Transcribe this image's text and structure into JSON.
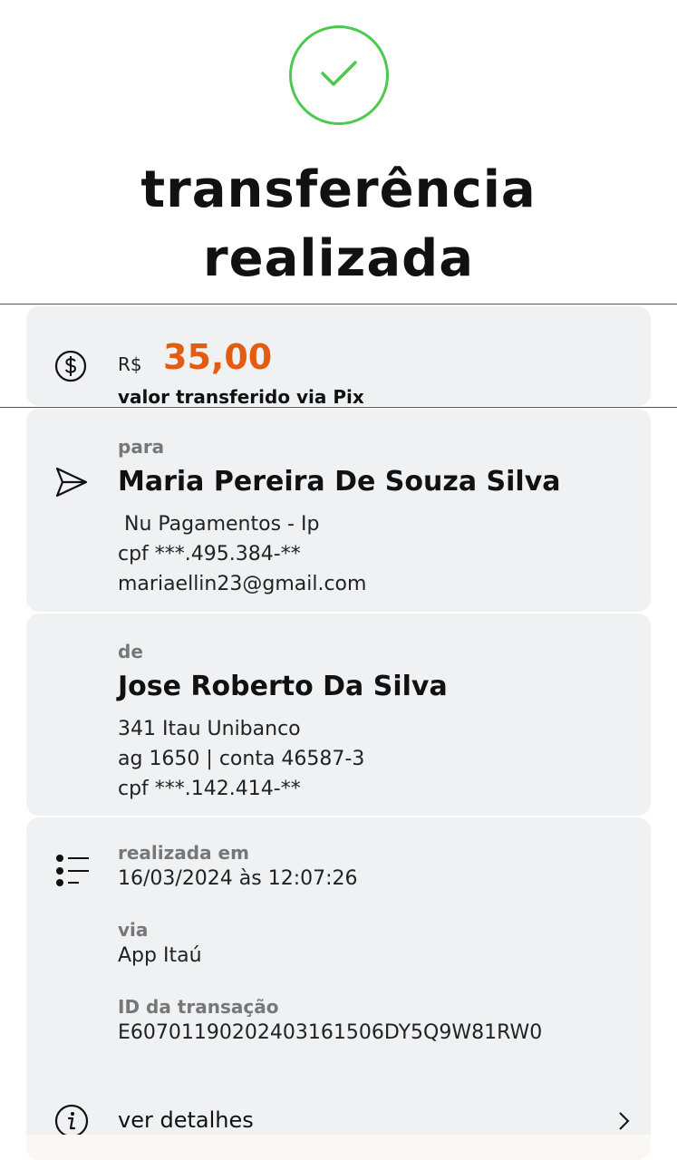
{
  "header": {
    "title_line1": "transferência",
    "title_line2": "realizada"
  },
  "amount": {
    "currency": "R$",
    "value": "35,00",
    "caption": "valor transferido via Pix"
  },
  "recipient": {
    "label": "para",
    "name": "Maria Pereira De Souza Silva",
    "bank": " Nu Pagamentos - Ip",
    "cpf": "cpf ***.495.384-**",
    "key": "mariaellin23@gmail.com"
  },
  "sender": {
    "label": "de",
    "name": "Jose Roberto Da Silva",
    "bank": "341 Itau Unibanco",
    "account": "ag 1650 | conta 46587-3",
    "cpf": "cpf ***.142.414-**"
  },
  "info": {
    "date_label": "realizada em",
    "date_value": "16/03/2024 às 12:07:26",
    "via_label": "via",
    "via_value": "App Itaú",
    "id_label": "ID da transação",
    "id_value": "E60701190202403161506DY5Q9W81RW0"
  },
  "details": {
    "label": "ver detalhes"
  },
  "colors": {
    "success_green": "#4cc94f",
    "amount_orange": "#e35c12",
    "card_bg": "#f0f1f3"
  },
  "icons": [
    "check-icon",
    "dollar-icon",
    "send-icon",
    "list-icon",
    "info-icon",
    "chevron-right-icon"
  ]
}
